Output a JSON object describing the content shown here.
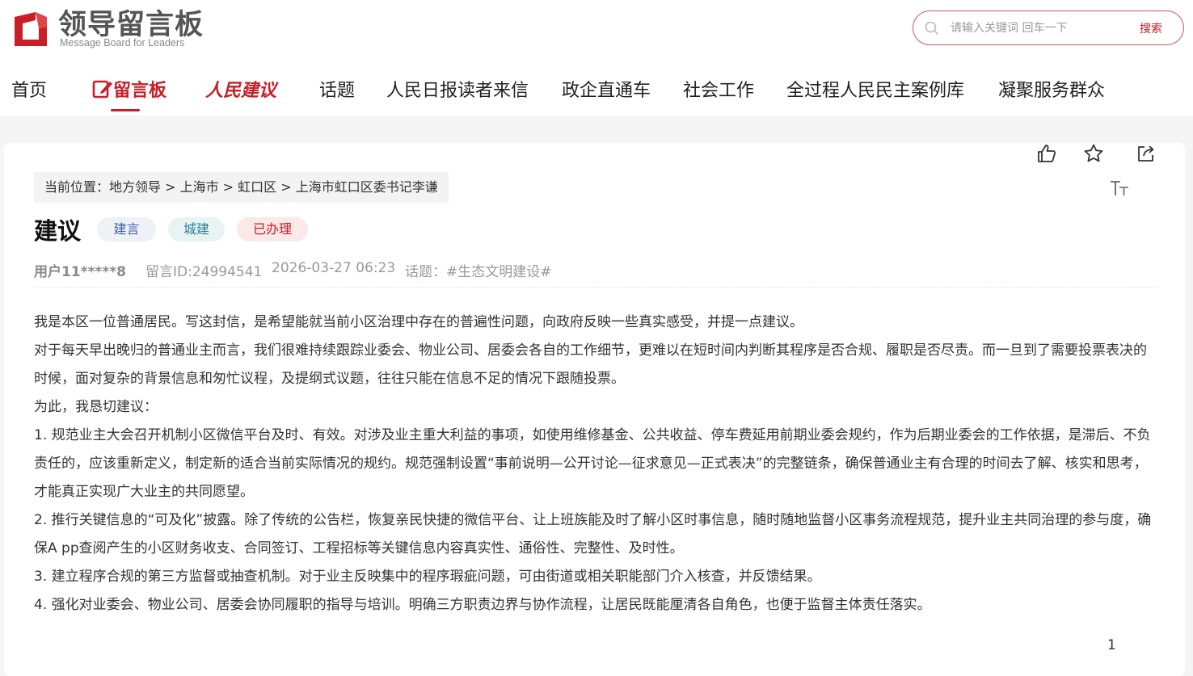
{
  "logo": {
    "title": "领导留言板",
    "subtitle": "Message Board for Leaders"
  },
  "search": {
    "placeholder": "请输入关键词 回车一下",
    "button": "搜索"
  },
  "nav": {
    "home": "首页",
    "board": "留言板",
    "suggest": "人民建议",
    "topics": "话题",
    "letters": "人民日报读者来信",
    "enterprise": "政企直通车",
    "social": "社会工作",
    "cases": "全过程人民民主案例库",
    "groups": "凝聚服务群众"
  },
  "breadcrumb": "当前位置：地方领导 > 上海市 > 虹口区 > 上海市虹口区委书记李谦",
  "message": {
    "title": "建议",
    "tags": [
      "建言",
      "城建",
      "已办理"
    ],
    "user": "用户11*****8",
    "id": "留言ID:24994541",
    "time": "2026-03-27 06:23",
    "topic": "话题：#生态文明建设#",
    "paragraphs": [
      "我是本区一位普通居民。写这封信，是希望能就当前小区治理中存在的普遍性问题，向政府反映一些真实感受，并提一点建议。",
      "对于每天早出晚归的普通业主而言，我们很难持续跟踪业委会、物业公司、居委会各自的工作细节，更难以在短时间内判断其程序是否合规、履职是否尽责。而一旦到了需要投票表决的时候，面对复杂的背景信息和匆忙议程，及提纲式议题，往往只能在信息不足的情况下跟随投票。",
      "为此，我恳切建议：",
      "1. 规范业主大会召开机制小区微信平台及时、有效。对涉及业主重大利益的事项，如使用维修基金、公共收益、停车费延用前期业委会规约，作为后期业委会的工作依据，是滞后、不负责任的，应该重新定义，制定新的适合当前实际情况的规约。规范强制设置“事前说明—公开讨论—征求意见—正式表决”的完整链条，确保普通业主有合理的时间去了解、核实和思考，才能真正实现广大业主的共同愿望。",
      "2. 推行关键信息的“可及化”披露。除了传统的公告栏，恢复亲民快捷的微信平台、让上班族能及时了解小区时事信息，随时随地监督小区事务流程规范，提升业主共同治理的参与度，确保A pp查阅产生的小区财务收支、合同签订、工程招标等关键信息内容真实性、通俗性、完整性、及时性。",
      "3. 建立程序合规的第三方监督或抽查机制。对于业主反映集中的程序瑕疵问题，可由街道或相关职能部门介入核查，并反馈结果。",
      "4. 强化对业委会、物业公司、居委会协同履职的指导与培训。明确三方职责边界与协作流程，让居民既能厘清各自角色，也便于监督主体责任落实。"
    ]
  },
  "actions": {
    "favorite_count": "1"
  },
  "colors": {
    "brand_red": "#c81e28"
  }
}
